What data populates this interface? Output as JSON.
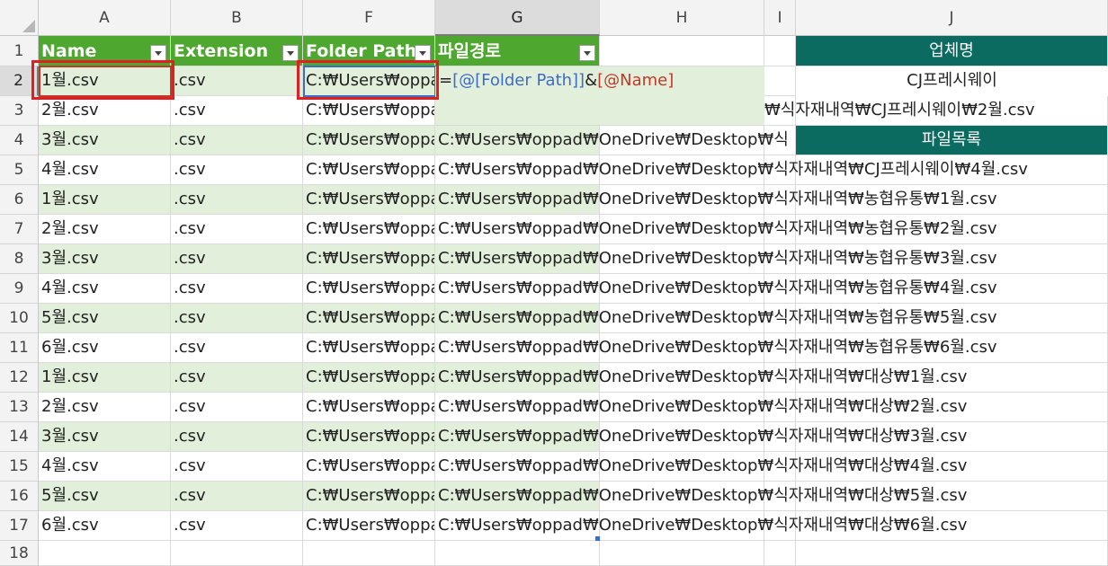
{
  "columns": [
    "A",
    "B",
    "F",
    "G",
    "H",
    "I",
    "J"
  ],
  "rows": [
    "1",
    "2",
    "3",
    "4",
    "5",
    "6",
    "7",
    "8",
    "9",
    "10",
    "11",
    "12",
    "13",
    "14",
    "15",
    "16",
    "17",
    "18"
  ],
  "table": {
    "headers": [
      "Name",
      "Extension",
      "Folder Path",
      "파일경로"
    ],
    "names": [
      "1월.csv",
      "2월.csv",
      "3월.csv",
      "4월.csv",
      "1월.csv",
      "2월.csv",
      "3월.csv",
      "4월.csv",
      "5월.csv",
      "6월.csv",
      "1월.csv",
      "2월.csv",
      "3월.csv",
      "4월.csv",
      "5월.csv",
      "6월.csv"
    ],
    "extension": ".csv",
    "folder_path_visible": "C:₩Users₩oppa",
    "paths": [
      "",
      "₩식자재내역₩CJ프레시웨이₩2월.csv",
      "C:₩Users₩oppad₩OneDrive₩Desktop₩식",
      "C:₩Users₩oppad₩OneDrive₩Desktop₩식자재내역₩CJ프레시웨이₩4월.csv",
      "C:₩Users₩oppad₩OneDrive₩Desktop₩식자재내역₩농협유통₩1월.csv",
      "C:₩Users₩oppad₩OneDrive₩Desktop₩식자재내역₩농협유통₩2월.csv",
      "C:₩Users₩oppad₩OneDrive₩Desktop₩식자재내역₩농협유통₩3월.csv",
      "C:₩Users₩oppad₩OneDrive₩Desktop₩식자재내역₩농협유통₩4월.csv",
      "C:₩Users₩oppad₩OneDrive₩Desktop₩식자재내역₩농협유통₩5월.csv",
      "C:₩Users₩oppad₩OneDrive₩Desktop₩식자재내역₩농협유통₩6월.csv",
      "C:₩Users₩oppad₩OneDrive₩Desktop₩식자재내역₩대상₩1월.csv",
      "C:₩Users₩oppad₩OneDrive₩Desktop₩식자재내역₩대상₩2월.csv",
      "C:₩Users₩oppad₩OneDrive₩Desktop₩식자재내역₩대상₩3월.csv",
      "C:₩Users₩oppad₩OneDrive₩Desktop₩식자재내역₩대상₩4월.csv",
      "C:₩Users₩oppad₩OneDrive₩Desktop₩식자재내역₩대상₩5월.csv",
      "C:₩Users₩oppad₩OneDrive₩Desktop₩식자재내역₩대상₩6월.csv"
    ]
  },
  "formula": {
    "eq": "=",
    "ref1": "[@[Folder Path]]",
    "amp": "&",
    "ref2": "[@Name]"
  },
  "side": {
    "company_header": "업체명",
    "company_value": "CJ프레시웨이",
    "file_list_header": "파일목록"
  },
  "colors": {
    "table_header": "#4ea72e",
    "band": "#e2efda",
    "teal": "#0b6b60",
    "highlight": "#e02020"
  }
}
